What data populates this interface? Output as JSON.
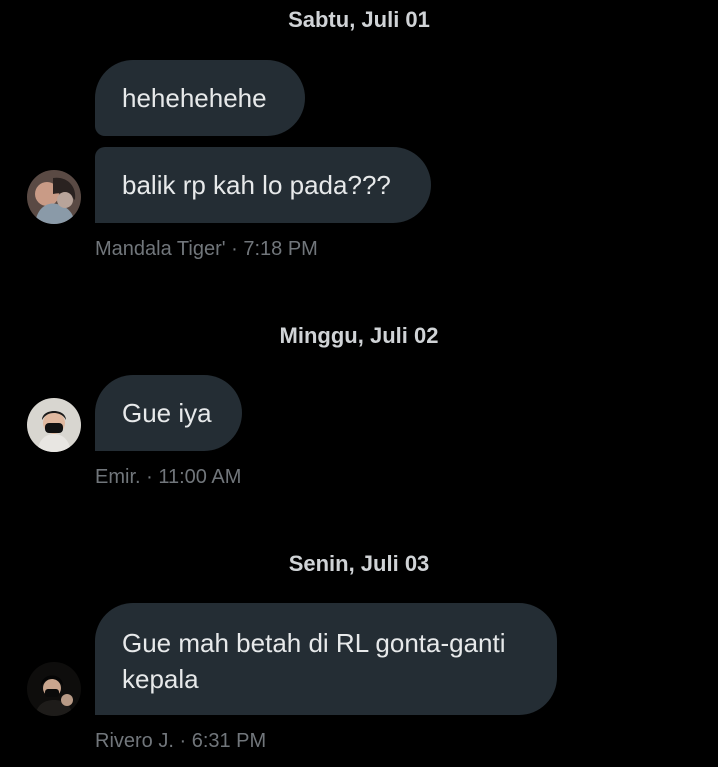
{
  "conversation": {
    "groups": [
      {
        "date": "Sabtu, Juli 01",
        "messages": [
          "hehehehehe",
          "balik rp kah lo pada???"
        ],
        "sender": "Mandala Tiger'",
        "separator": "·",
        "time": "7:18 PM",
        "avatar_icon": "user-avatar-icon"
      },
      {
        "date": "Minggu, Juli 02",
        "messages": [
          "Gue iya"
        ],
        "sender": "Emir.",
        "separator": "·",
        "time": "11:00 AM",
        "avatar_icon": "user-avatar-icon"
      },
      {
        "date": "Senin, Juli 03",
        "messages": [
          "Gue mah betah di RL gonta-ganti",
          "kepala"
        ],
        "sender": "Rivero J.",
        "separator": "·",
        "time": "6:31 PM",
        "avatar_icon": "user-avatar-icon"
      }
    ]
  },
  "colors": {
    "background": "#000000",
    "bubble": "#242d34",
    "message_text": "#e7e9ea",
    "meta_text": "#71767b",
    "date_text": "#d0d3d6"
  }
}
